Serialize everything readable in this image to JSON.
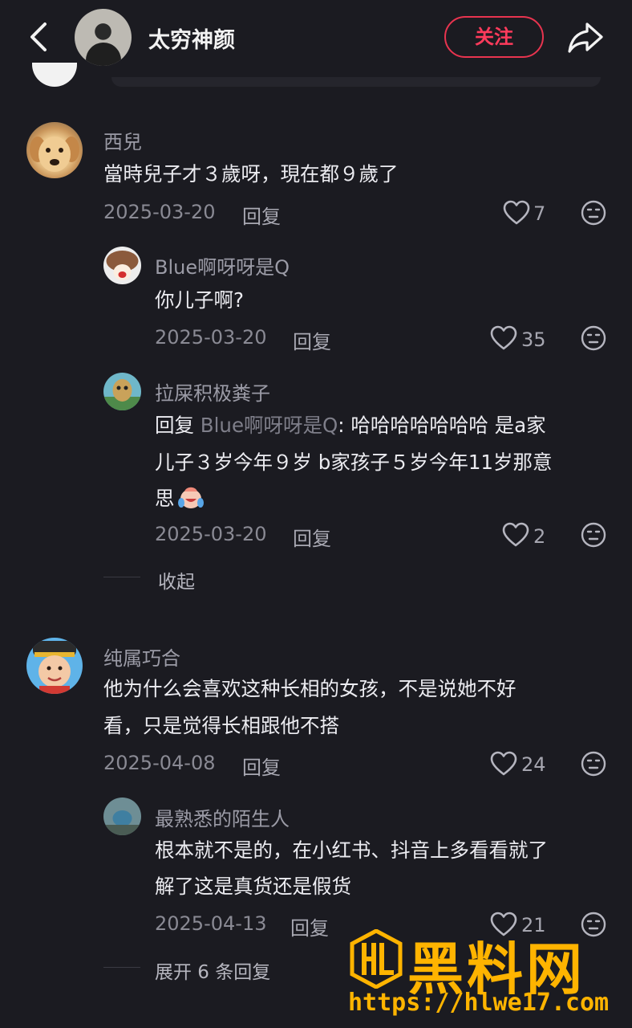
{
  "header": {
    "username": "太穷神颜",
    "follow_label": "关注"
  },
  "comments": [
    {
      "user": "西兒",
      "text": "當時兒子才３歲呀，現在都９歲了",
      "date": "2025-03-20",
      "reply_label": "回复",
      "likes": "7",
      "replies": [
        {
          "user": "Blue啊呀呀是Q",
          "text": "你儿子啊?",
          "date": "2025-03-20",
          "reply_label": "回复",
          "likes": "35"
        },
        {
          "user": "拉屎积极粪子",
          "reply_prefix": "回复 ",
          "reply_to": "Blue啊呀呀是Q",
          "text_line1": ": 哈哈哈哈哈哈哈 是a家",
          "text_line2": "儿子３岁今年９岁 b家孩子５岁今年11岁那意",
          "text_line3": "思",
          "date": "2025-03-20",
          "reply_label": "回复",
          "likes": "2"
        }
      ],
      "collapse_label": "收起"
    },
    {
      "user": "纯属巧合",
      "text_line1": "他为什么会喜欢这种长相的女孩，不是说她不好",
      "text_line2": "看，只是觉得长相跟他不搭",
      "date": "2025-04-08",
      "reply_label": "回复",
      "likes": "24",
      "replies": [
        {
          "user": "最熟悉的陌生人",
          "text_line1": "根本就不是的，在小红书、抖音上多看看就了",
          "text_line2": "解了这是真货还是假货",
          "date": "2025-04-13",
          "reply_label": "回复",
          "likes": "21"
        }
      ],
      "expand_label": "展开 6 条回复"
    }
  ],
  "watermark": {
    "title": "黑料网",
    "url": "https://hlwe17.com"
  },
  "colors": {
    "background": "#1b1b21",
    "accent": "#ff3b5c",
    "watermark": "#ffb400"
  }
}
